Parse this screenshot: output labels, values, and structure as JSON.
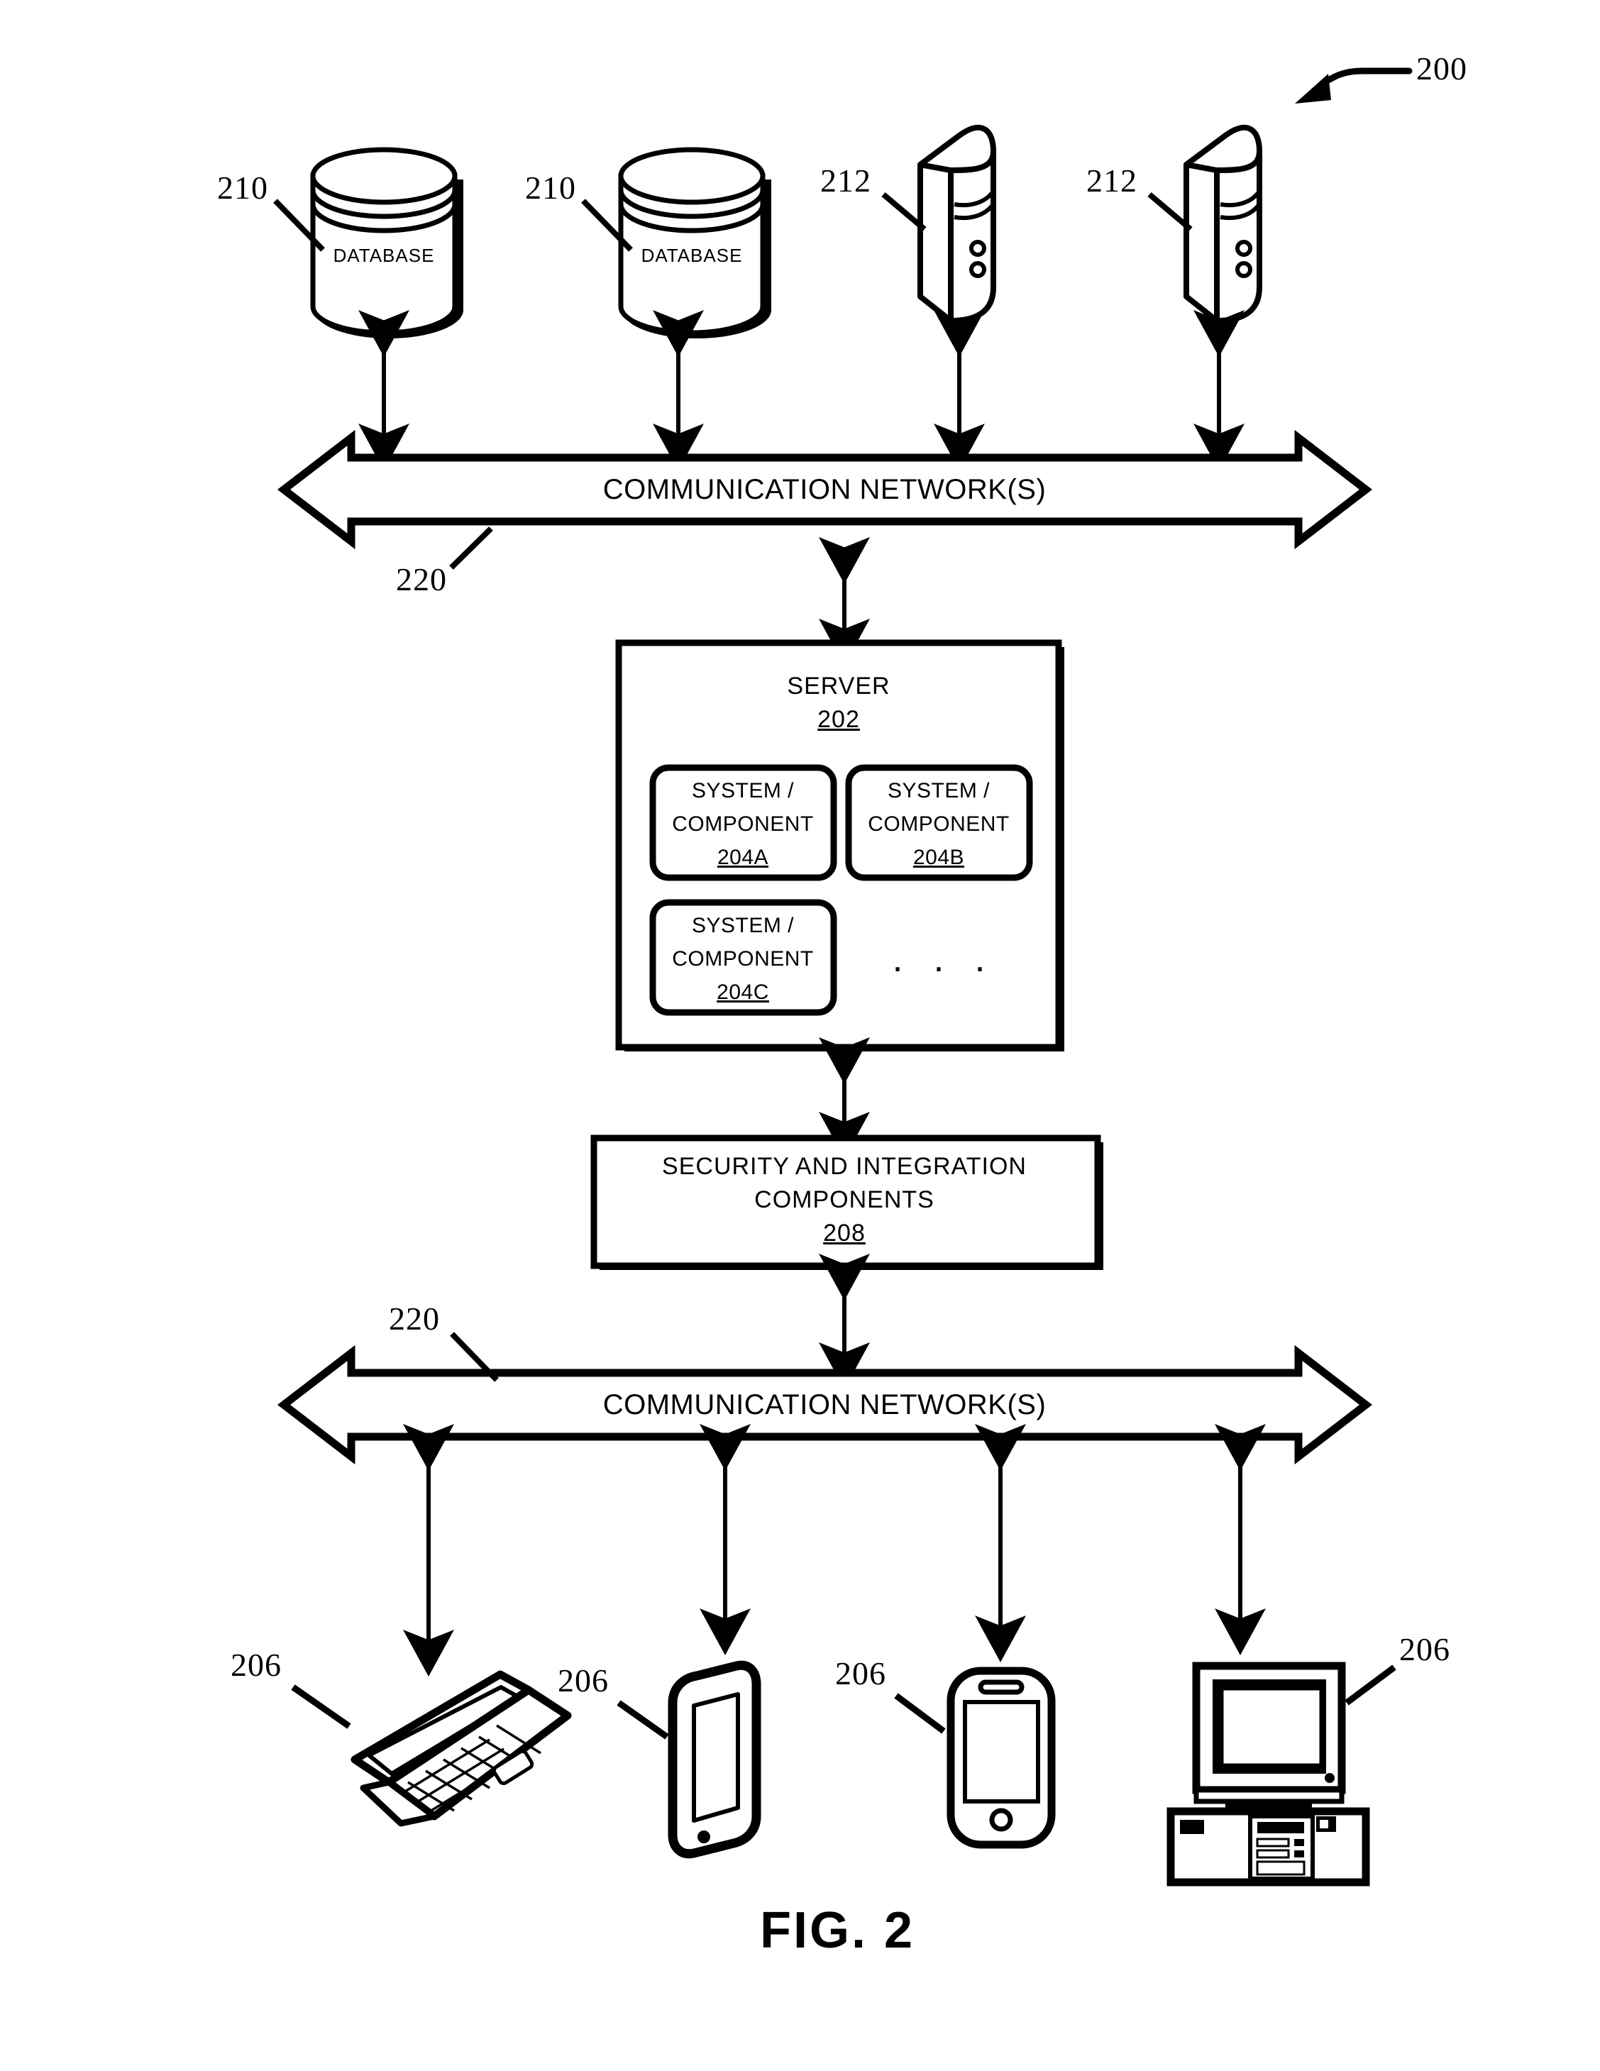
{
  "figure": {
    "caption": "FIG. 2",
    "system_ref": "200"
  },
  "databases": [
    {
      "label": "DATABASE",
      "ref": "210"
    },
    {
      "label": "DATABASE",
      "ref": "210"
    }
  ],
  "servers_external": [
    {
      "ref": "212"
    },
    {
      "ref": "212"
    }
  ],
  "networks": [
    {
      "label": "COMMUNICATION NETWORK(S)",
      "ref": "220"
    },
    {
      "label": "COMMUNICATION NETWORK(S)",
      "ref": "220"
    }
  ],
  "server_box": {
    "title": "SERVER",
    "ref": "202",
    "ellipsis": ". . .",
    "components": [
      {
        "line1": "SYSTEM /",
        "line2": "COMPONENT",
        "ref": "204A"
      },
      {
        "line1": "SYSTEM /",
        "line2": "COMPONENT",
        "ref": "204B"
      },
      {
        "line1": "SYSTEM /",
        "line2": "COMPONENT",
        "ref": "204C"
      }
    ]
  },
  "security_box": {
    "line1": "SECURITY AND INTEGRATION",
    "line2": "COMPONENTS",
    "ref": "208"
  },
  "client_devices": [
    {
      "type": "laptop",
      "ref": "206"
    },
    {
      "type": "tablet",
      "ref": "206"
    },
    {
      "type": "smartphone",
      "ref": "206"
    },
    {
      "type": "desktop-computer",
      "ref": "206"
    }
  ],
  "colors": {
    "ink": "#000000",
    "paper": "#ffffff"
  }
}
